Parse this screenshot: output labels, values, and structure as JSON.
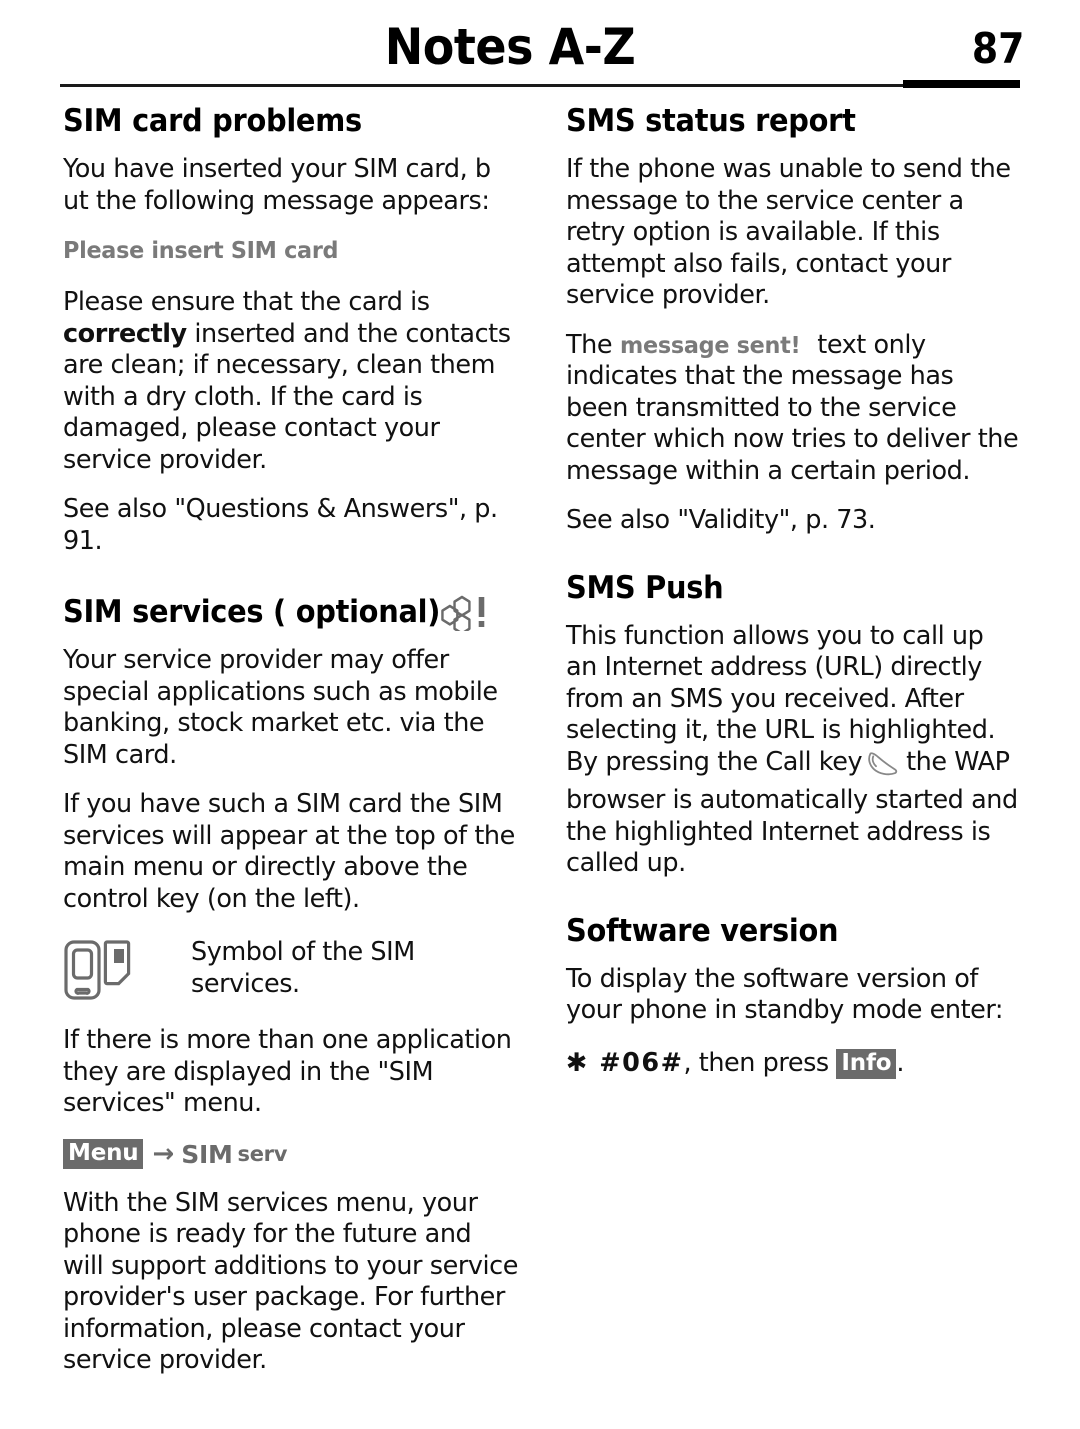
{
  "header": {
    "title": "Notes A-Z",
    "page_number": "87"
  },
  "left_column": {
    "section1": {
      "heading": "SIM card problems",
      "p1": "You have inserted your SIM card, b ut the following message appears:",
      "display_message": "Please insert SIM card",
      "p2_part1": "Please ensure that the card is ",
      "p2_bold": "correctly",
      "p2_part2": " inserted and the contacts are clean; if necessary, clean them with a dry cloth. If the card is damaged, please contact your service provider.",
      "p3": "See also \"Questions & Answers\", p. 91."
    },
    "section2": {
      "heading": "SIM services ( optional)",
      "heading_icon": "hexagon-cluster-icon",
      "p1": "Your service provider may offer special applications such as mobile banking, stock market etc. via the SIM card.",
      "p2": "If you have such a SIM card the SIM services will appear at the top of the main menu or directly above the control key (on the left).",
      "symbol_icon": "phone-and-sim-card-icon",
      "symbol_description": "Symbol of the SIM services.",
      "p3": "If there is more than one application they are displayed in the \"SIM services\" menu.",
      "menu_path": {
        "softkey": "Menu",
        "arrow": "→",
        "target_main": "SIM",
        "target_sub": "serv"
      },
      "p4": "With the SIM services menu, your phone is ready for the future and will support additions to your service provider's user package. For further information, please contact your service provider."
    }
  },
  "right_column": {
    "section1": {
      "heading": "SMS status report",
      "p1": "If the phone was unable to send the message to the service center a retry option is available. If this attempt also fails, contact your service provider.",
      "p2_part1": "The ",
      "p2_display": "message sent!",
      "p2_part2": " text only indicates that the message has been transmitted to the service center which now tries to deliver the message within a certain period.",
      "p3": "See also \"Validity\", p. 73."
    },
    "section2": {
      "heading": "SMS Push",
      "p_part1": "This function allows you to call up an Internet address (URL) directly from an SMS you received. After selecting it, the URL is highlighted. By pressing the Call key",
      "call_key_icon": "call-key-icon",
      "p_part2": "the WAP browser is automatically started and the highlighted Internet address is called up."
    },
    "section3": {
      "heading": "Software version",
      "p1": "To display the software version of your phone in standby mode enter:",
      "code": "✱ #06#",
      "code_tail": ", then press ",
      "softkey": "Info",
      "code_end": "."
    }
  },
  "colors": {
    "text": "#111111",
    "display_gray": "#7a7a7a",
    "softkey_bg": "#6b6b6b",
    "softkey_fg": "#ffffff",
    "icon_gray": "#6b6b6b",
    "rule": "#000000"
  }
}
